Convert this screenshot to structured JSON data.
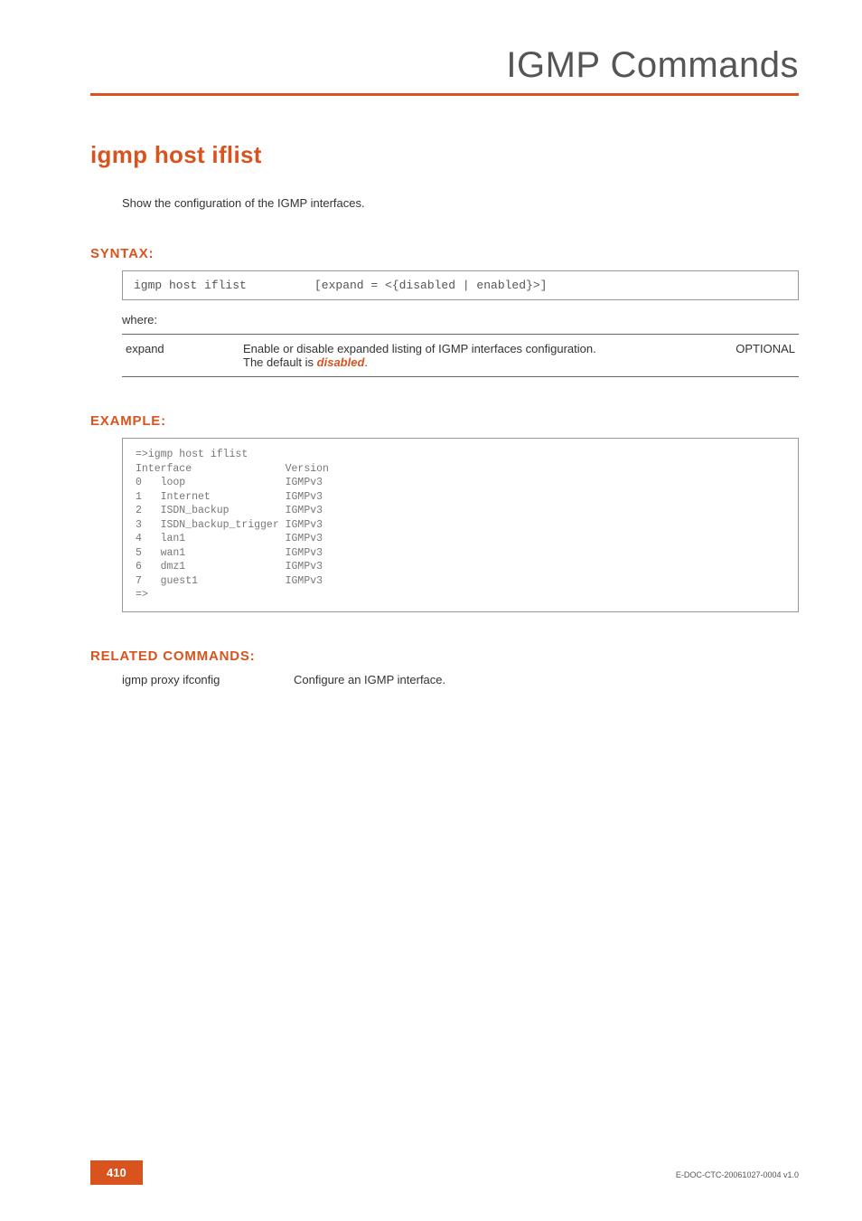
{
  "chapter": "IGMP Commands",
  "command_title": "igmp host iflist",
  "description": "Show the configuration of the IGMP interfaces.",
  "syntax": {
    "label": "SYNTAX:",
    "cmd": "igmp host iflist",
    "args": "[expand = <{disabled | enabled}>]",
    "where": "where:",
    "params": [
      {
        "name": "expand",
        "desc_pre": "Enable or disable expanded listing of IGMP interfaces configuration.",
        "desc_default_label": "The default is ",
        "desc_default_value": "disabled",
        "desc_default_suffix": ".",
        "opt": "OPTIONAL"
      }
    ]
  },
  "example": {
    "label": "EXAMPLE:",
    "text": "=>igmp host iflist\nInterface               Version\n0   loop                IGMPv3\n1   Internet            IGMPv3\n2   ISDN_backup         IGMPv3\n3   ISDN_backup_trigger IGMPv3\n4   lan1                IGMPv3\n5   wan1                IGMPv3\n6   dmz1                IGMPv3\n7   guest1              IGMPv3\n=>"
  },
  "related": {
    "label": "RELATED COMMANDS:",
    "rows": [
      {
        "cmd": "igmp proxy ifconfig",
        "desc": "Configure an IGMP interface."
      }
    ]
  },
  "footer": {
    "page": "410",
    "docid": "E-DOC-CTC-20061027-0004 v1.0"
  }
}
